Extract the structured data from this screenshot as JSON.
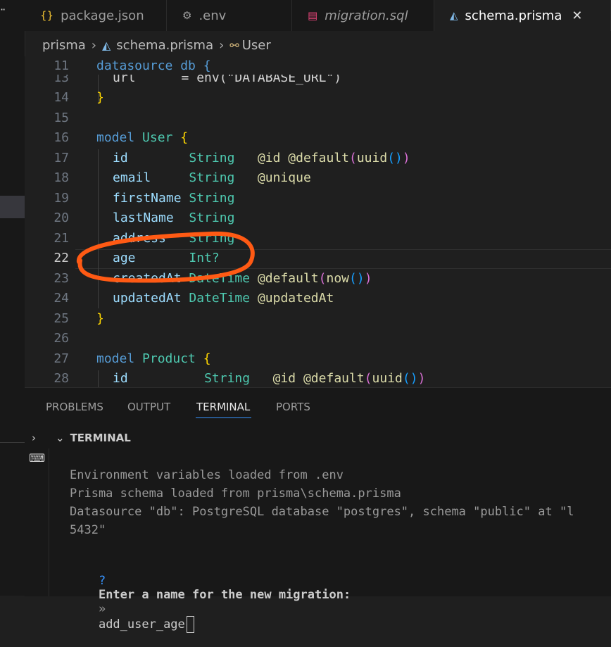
{
  "tabs": [
    {
      "label": "package.json",
      "icon": "braces-icon",
      "icon_glyph": "{}"
    },
    {
      "label": ".env",
      "icon": "gear-icon",
      "icon_glyph": "⚙"
    },
    {
      "label": "migration.sql",
      "icon": "database-icon",
      "icon_glyph": "▤"
    },
    {
      "label": "schema.prisma",
      "icon": "prisma-icon",
      "icon_glyph": "◭",
      "close_glyph": "✕"
    }
  ],
  "breadcrumb": {
    "folder": "prisma",
    "file": "schema.prisma",
    "symbol": "User",
    "separator": "›"
  },
  "editor": {
    "current_line": 22,
    "lines": [
      {
        "n": "11",
        "text": "datasource db {"
      },
      {
        "n": "13",
        "text": "url      = env(\"DATABASE_URL\")"
      },
      {
        "n": "14",
        "text": "}"
      },
      {
        "n": "15",
        "text": ""
      },
      {
        "n": "16",
        "text": "model User {"
      },
      {
        "n": "17",
        "text": "id        String   @id @default(uuid())"
      },
      {
        "n": "18",
        "text": "email     String   @unique"
      },
      {
        "n": "19",
        "text": "firstName String"
      },
      {
        "n": "20",
        "text": "lastName  String"
      },
      {
        "n": "21",
        "text": "address   String"
      },
      {
        "n": "22",
        "text": "age       Int?"
      },
      {
        "n": "23",
        "text": "createdAt DateTime @default(now())"
      },
      {
        "n": "24",
        "text": "updatedAt DateTime @updatedAt"
      },
      {
        "n": "25",
        "text": "}"
      },
      {
        "n": "26",
        "text": ""
      },
      {
        "n": "27",
        "text": "model Product {"
      },
      {
        "n": "28",
        "text": "id          String   @id @default(uuid())"
      }
    ]
  },
  "panel": {
    "tabs": [
      "PROBLEMS",
      "OUTPUT",
      "TERMINAL",
      "PORTS"
    ],
    "active_tab": "TERMINAL",
    "section_title": "TERMINAL",
    "terminal_lines": [
      "Environment variables loaded from .env",
      "Prisma schema loaded from prisma\\schema.prisma",
      "Datasource \"db\": PostgreSQL database \"postgres\", schema \"public\" at \"l",
      "5432\""
    ],
    "prompt": {
      "symbol": "?",
      "question": "Enter a name for the new migration:",
      "arrow": "»",
      "input_value": "add_user_age"
    }
  },
  "colors": {
    "accent": "#3794ff",
    "annotation": "#ff5a14",
    "background": "#1f1f1f"
  }
}
